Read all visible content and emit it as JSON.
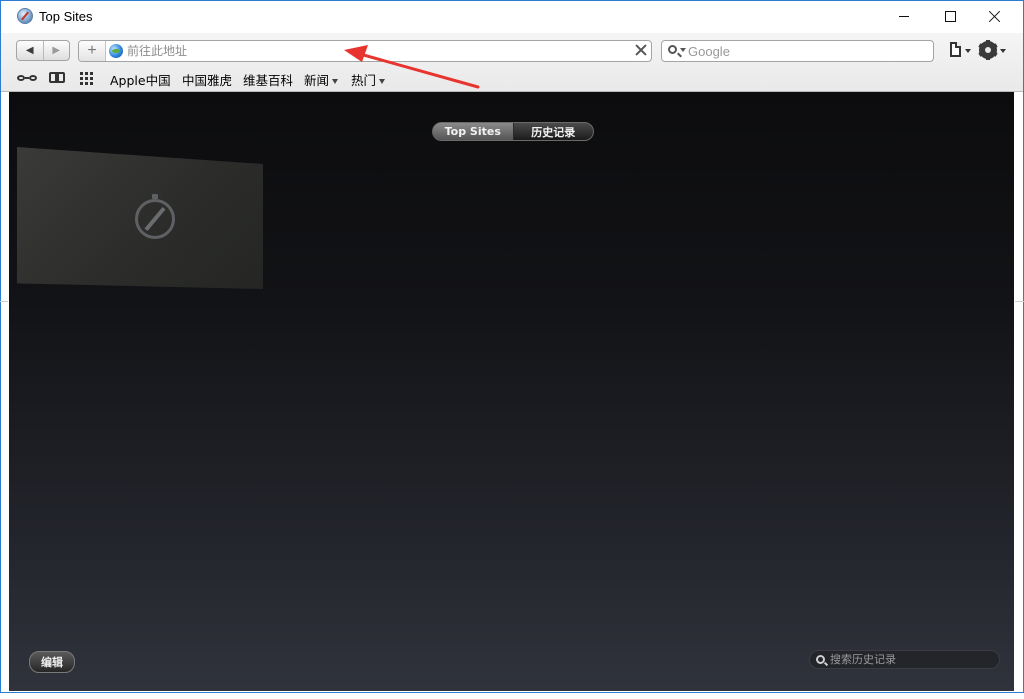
{
  "window": {
    "title": "Top Sites",
    "controls": {
      "minimize": "minimize",
      "maximize": "maximize",
      "close": "close"
    }
  },
  "toolbar": {
    "address": {
      "placeholder": "前往此地址",
      "value": ""
    },
    "search": {
      "placeholder": "Google",
      "value": ""
    }
  },
  "bookmarks": {
    "items": [
      {
        "label": "Apple中国"
      },
      {
        "label": "中国雅虎"
      },
      {
        "label": "维基百科"
      },
      {
        "label": "新闻",
        "has_menu": true
      },
      {
        "label": "热门",
        "has_menu": true
      }
    ]
  },
  "content": {
    "tabs": [
      {
        "label": "Top Sites",
        "active": true
      },
      {
        "label": "历史记录",
        "active": false
      }
    ],
    "edit_label": "编辑",
    "history_search": {
      "placeholder": "搜索历史记录",
      "value": ""
    }
  },
  "colors": {
    "window_border": "#2b7cd3",
    "annotation_arrow": "#e8342f",
    "content_top": "#0c0c0e",
    "content_bottom": "#30333c"
  },
  "icons": {
    "app": "safari-compass-icon",
    "reader": "glasses-icon",
    "bookmarks": "book-icon",
    "top_sites_grid": "grid-icon",
    "page_menu": "page-icon",
    "settings": "gear-icon"
  }
}
